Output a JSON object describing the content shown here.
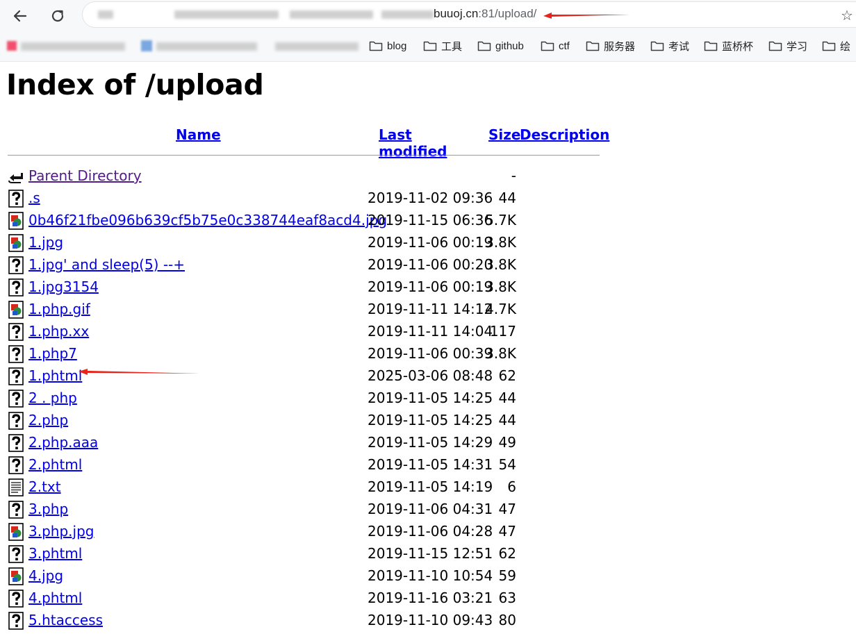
{
  "browser": {
    "url_host_visible": "buuoj.cn",
    "url_rest": ":81/upload/",
    "bookmarks": [
      "blog",
      "工具",
      "github",
      "ctf",
      "服务器",
      "考试",
      "蓝桥杯",
      "学习",
      "绘"
    ]
  },
  "page": {
    "title": "Index of /upload",
    "columns": {
      "name": "Name",
      "modified": "Last modified",
      "size": "Size",
      "description": "Description"
    },
    "parent": {
      "name": "Parent Directory",
      "size": "-"
    },
    "files": [
      {
        "name": ".s",
        "modified": "2019-11-02 09:36",
        "size": "44",
        "icon": "unknown-file-icon"
      },
      {
        "name": "0b46f21fbe096b639cf5b75e0c338744eaf8acd4.jpg",
        "modified": "2019-11-15 06:36",
        "size": "5.7K",
        "icon": "image-file-icon"
      },
      {
        "name": "1.jpg",
        "modified": "2019-11-06 00:19",
        "size": "3.8K",
        "icon": "image-file-icon"
      },
      {
        "name": "1.jpg' and sleep(5) --+",
        "modified": "2019-11-06 00:20",
        "size": "3.8K",
        "icon": "unknown-file-icon"
      },
      {
        "name": "1.jpg3154",
        "modified": "2019-11-06 00:19",
        "size": "3.8K",
        "icon": "unknown-file-icon"
      },
      {
        "name": "1.php.gif",
        "modified": "2019-11-11 14:12",
        "size": "4.7K",
        "icon": "image-file-icon"
      },
      {
        "name": "1.php.xx",
        "modified": "2019-11-11 14:04",
        "size": "117",
        "icon": "unknown-file-icon"
      },
      {
        "name": "1.php7",
        "modified": "2019-11-06 00:39",
        "size": "3.8K",
        "icon": "unknown-file-icon"
      },
      {
        "name": "1.phtml",
        "modified": "2025-03-06 08:48",
        "size": "62",
        "icon": "unknown-file-icon"
      },
      {
        "name": "2 . php",
        "modified": "2019-11-05 14:25",
        "size": "44",
        "icon": "unknown-file-icon"
      },
      {
        "name": "2.php",
        "modified": "2019-11-05 14:25",
        "size": "44",
        "icon": "unknown-file-icon"
      },
      {
        "name": "2.php.aaa",
        "modified": "2019-11-05 14:29",
        "size": "49",
        "icon": "unknown-file-icon"
      },
      {
        "name": "2.phtml",
        "modified": "2019-11-05 14:31",
        "size": "54",
        "icon": "unknown-file-icon"
      },
      {
        "name": "2.txt",
        "modified": "2019-11-05 14:19",
        "size": "6",
        "icon": "text-file-icon"
      },
      {
        "name": "3.php",
        "modified": "2019-11-06 04:31",
        "size": "47",
        "icon": "unknown-file-icon"
      },
      {
        "name": "3.php.jpg",
        "modified": "2019-11-06 04:28",
        "size": "47",
        "icon": "image-file-icon"
      },
      {
        "name": "3.phtml",
        "modified": "2019-11-15 12:51",
        "size": "62",
        "icon": "unknown-file-icon"
      },
      {
        "name": "4.jpg",
        "modified": "2019-11-10 10:54",
        "size": "59",
        "icon": "image-file-icon"
      },
      {
        "name": "4.phtml",
        "modified": "2019-11-16 03:21",
        "size": "63",
        "icon": "unknown-file-icon"
      },
      {
        "name": "5.htaccess",
        "modified": "2019-11-10 09:43",
        "size": "80",
        "icon": "unknown-file-icon"
      }
    ]
  },
  "colors": {
    "link": "#0000ee",
    "visited_link": "#551a8b",
    "annotation_arrow": "#e8231a"
  }
}
